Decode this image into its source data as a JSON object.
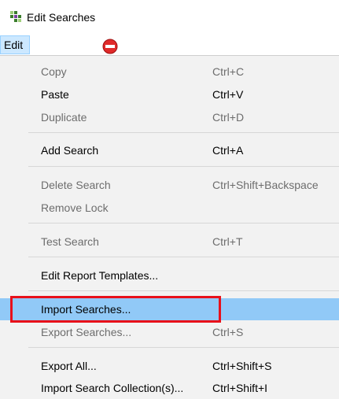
{
  "window": {
    "title": "Edit Searches",
    "app_icon": "app-icon"
  },
  "menubar": {
    "edit_label": "Edit",
    "stop_icon": "stop-icon",
    "accent_color": "#cce8ff"
  },
  "menu": {
    "items": [
      {
        "label": "Copy",
        "shortcut": "Ctrl+C",
        "enabled": false
      },
      {
        "label": "Paste",
        "shortcut": "Ctrl+V",
        "enabled": true
      },
      {
        "label": "Duplicate",
        "shortcut": "Ctrl+D",
        "enabled": false
      },
      {
        "label": "Add Search",
        "shortcut": "Ctrl+A",
        "enabled": true
      },
      {
        "label": "Delete Search",
        "shortcut": "Ctrl+Shift+Backspace",
        "enabled": false
      },
      {
        "label": "Remove Lock",
        "shortcut": "",
        "enabled": false
      },
      {
        "label": "Test Search",
        "shortcut": "Ctrl+T",
        "enabled": false
      },
      {
        "label": "Edit Report Templates...",
        "shortcut": "",
        "enabled": true
      },
      {
        "label": "Import Searches...",
        "shortcut": "",
        "enabled": true,
        "highlighted": true
      },
      {
        "label": "Export Searches...",
        "shortcut": "Ctrl+S",
        "enabled": false
      },
      {
        "label": "Export All...",
        "shortcut": "Ctrl+Shift+S",
        "enabled": true
      },
      {
        "label": "Import Search Collection(s)...",
        "shortcut": "Ctrl+Shift+I",
        "enabled": true
      }
    ],
    "hover_color": "#91c9f7",
    "annotation_color": "#e8101a"
  }
}
